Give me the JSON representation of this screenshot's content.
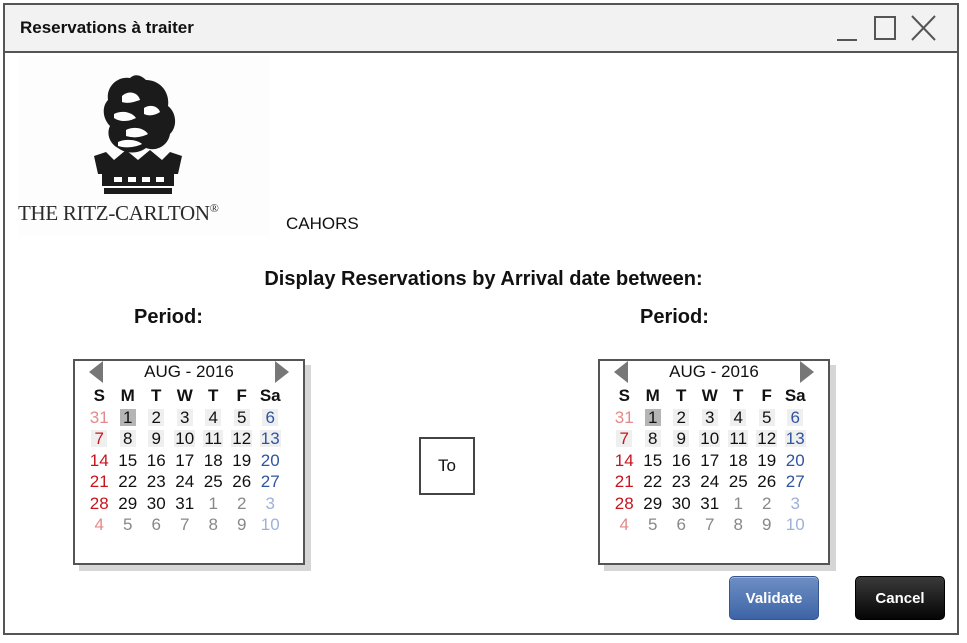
{
  "window": {
    "title": "Reservations à traiter",
    "controls": {
      "minimize_icon": "minimize-icon",
      "maximize_icon": "maximize-icon",
      "close_icon": "close-icon"
    }
  },
  "logo": {
    "text": "THE RITZ-CARLTON",
    "registered": "®",
    "image": "lion-crown-logo"
  },
  "city": "CAHORS",
  "heading": "Display Reservations by Arrival date between:",
  "from_period_label": "Period:",
  "to_period_label": "Period:",
  "to_label": "To",
  "calendar_from": {
    "month_label": "AUG - 2016",
    "weekdays": [
      "S",
      "M",
      "T",
      "W",
      "T",
      "F",
      "Sa"
    ],
    "weeks": [
      [
        "31",
        "1",
        "2",
        "3",
        "4",
        "5",
        "6"
      ],
      [
        "7",
        "8",
        "9",
        "10",
        "11",
        "12",
        "13"
      ],
      [
        "14",
        "15",
        "16",
        "17",
        "18",
        "19",
        "20"
      ],
      [
        "21",
        "22",
        "23",
        "24",
        "25",
        "26",
        "27"
      ],
      [
        "28",
        "29",
        "30",
        "31",
        "1",
        "2",
        "3"
      ],
      [
        "4",
        "5",
        "6",
        "7",
        "8",
        "9",
        "10"
      ]
    ],
    "selected_day": "1"
  },
  "calendar_to": {
    "month_label": "AUG - 2016",
    "weekdays": [
      "S",
      "M",
      "T",
      "W",
      "T",
      "F",
      "Sa"
    ],
    "weeks": [
      [
        "31",
        "1",
        "2",
        "3",
        "4",
        "5",
        "6"
      ],
      [
        "7",
        "8",
        "9",
        "10",
        "11",
        "12",
        "13"
      ],
      [
        "14",
        "15",
        "16",
        "17",
        "18",
        "19",
        "20"
      ],
      [
        "21",
        "22",
        "23",
        "24",
        "25",
        "26",
        "27"
      ],
      [
        "28",
        "29",
        "30",
        "31",
        "1",
        "2",
        "3"
      ],
      [
        "4",
        "5",
        "6",
        "7",
        "8",
        "9",
        "10"
      ]
    ],
    "selected_day": "1"
  },
  "buttons": {
    "validate": "Validate",
    "cancel": "Cancel"
  },
  "colors": {
    "sunday": "#c8141e",
    "saturday": "#3054a0",
    "validate_bg": "#4a6fb0",
    "cancel_bg": "#000000"
  }
}
